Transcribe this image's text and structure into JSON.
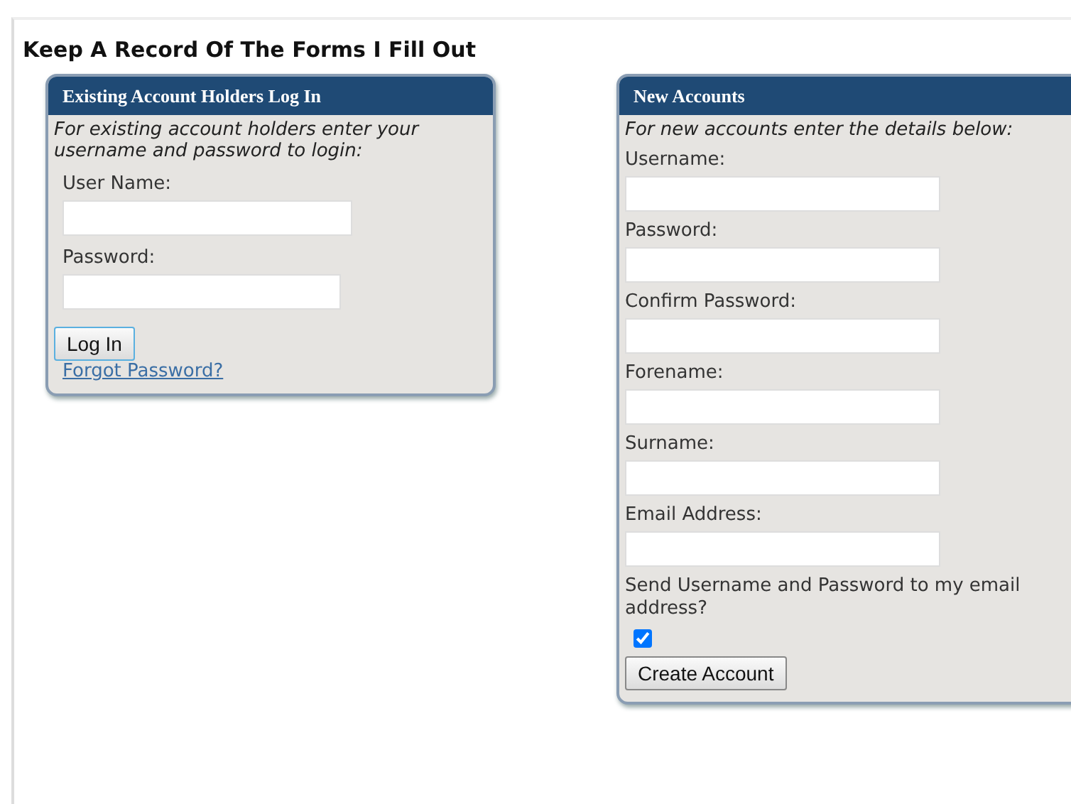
{
  "heading": "Keep A Record Of The Forms I Fill Out",
  "panels": [
    {
      "kind": "login",
      "title": "Existing Account Holders Log In",
      "intro": "For existing account holders enter your username and password to login:",
      "fields": [
        {
          "label": "User Name:"
        },
        {
          "label": "Password:"
        }
      ],
      "button": "Log In",
      "link": "Forgot Password?"
    },
    {
      "kind": "signup",
      "title": "New Accounts",
      "intro": "For new accounts enter the details below:",
      "fields": [
        {
          "label": "Username:"
        },
        {
          "label": "Password:"
        },
        {
          "label": "Confirm Password:"
        },
        {
          "label": "Forename:"
        },
        {
          "label": "Surname:"
        },
        {
          "label": "Email Address:"
        }
      ],
      "option": {
        "label": "Send Username and Password to my email address?",
        "checked": true
      },
      "button": "Create Account"
    }
  ]
}
